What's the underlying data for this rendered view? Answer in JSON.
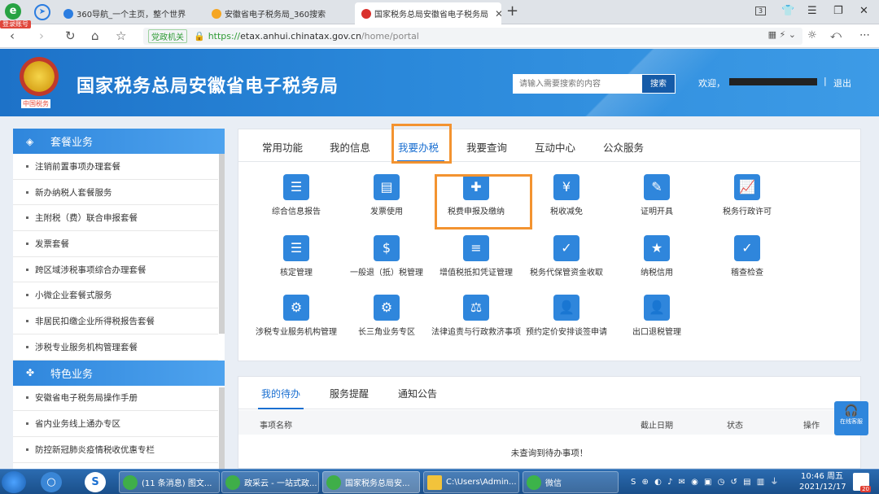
{
  "browser": {
    "brand_tag": "登录账号",
    "tabs": [
      {
        "title": "360导航_一个主页，整个世界",
        "active": false
      },
      {
        "title": "安徽省电子税务局_360搜索",
        "active": false
      },
      {
        "title": "国家税务总局安徽省电子税务局",
        "active": true
      }
    ],
    "tab_count": "3",
    "gov_badge": "党政机关",
    "url_scheme": "https://",
    "url_domain": "etax.anhui.chinatax.gov.cn",
    "url_path": "/home/portal"
  },
  "header": {
    "emblem_caption": "中国税务",
    "site_title": "国家税务总局安徽省电子税务局",
    "search_placeholder": "请输入需要搜索的内容",
    "search_button": "搜索",
    "welcome": "欢迎，",
    "logout": "退出"
  },
  "sidebar": {
    "section1": {
      "title": "套餐业务",
      "items": [
        "注销前置事项办理套餐",
        "新办纳税人套餐服务",
        "主附税（费）联合申报套餐",
        "发票套餐",
        "跨区域涉税事项综合办理套餐",
        "小微企业套餐式服务",
        "非居民扣缴企业所得税报告套餐",
        "涉税专业服务机构管理套餐"
      ]
    },
    "section2": {
      "title": "特色业务",
      "items": [
        "安徽省电子税务局操作手册",
        "省内业务线上通办专区",
        "防控新冠肺炎疫情税收优惠专栏"
      ]
    }
  },
  "main": {
    "tabs": [
      "常用功能",
      "我的信息",
      "我要办税",
      "我要查询",
      "互动中心",
      "公众服务"
    ],
    "active_tab": "我要办税",
    "tiles": [
      {
        "label": "综合信息报告",
        "color": "#2f86dc"
      },
      {
        "label": "发票使用",
        "color": "#2f86dc"
      },
      {
        "label": "税费申报及缴纳",
        "color": "#2f86dc"
      },
      {
        "label": "税收减免",
        "color": "#2f86dc"
      },
      {
        "label": "证明开具",
        "color": "#2f86dc"
      },
      {
        "label": "税务行政许可",
        "color": "#2f86dc"
      },
      {
        "label": "核定管理",
        "color": "#2f86dc"
      },
      {
        "label": "一般退（抵）税管理",
        "color": "#2f86dc"
      },
      {
        "label": "增值税抵扣凭证管理",
        "color": "#2f86dc"
      },
      {
        "label": "税务代保管资金收取",
        "color": "#2f86dc"
      },
      {
        "label": "纳税信用",
        "color": "#2f86dc"
      },
      {
        "label": "稽查检查",
        "color": "#2f86dc"
      },
      {
        "label": "涉税专业服务机构管理",
        "color": "#2f86dc"
      },
      {
        "label": "长三角业务专区",
        "color": "#2f86dc"
      },
      {
        "label": "法律追责与行政救济事项",
        "color": "#2f86dc"
      },
      {
        "label": "预约定价安排谈签申请",
        "color": "#2f86dc"
      },
      {
        "label": "出口退税管理",
        "color": "#2f86dc"
      }
    ]
  },
  "todo": {
    "tabs": [
      "我的待办",
      "服务提醒",
      "通知公告"
    ],
    "active_tab": "我的待办",
    "columns": [
      "事项名称",
      "截止日期",
      "状态",
      "操作"
    ],
    "empty_text": "未查询到待办事项！"
  },
  "online_service": "在线客服",
  "taskbar": {
    "items": [
      "(11 条消息) 图文...",
      "政采云 - 一站式政...",
      "国家税务总局安...",
      "C:\\Users\\Admin...",
      "微信"
    ],
    "time": "10:46 周五",
    "date": "2021/12/17",
    "notif_count": "20"
  }
}
